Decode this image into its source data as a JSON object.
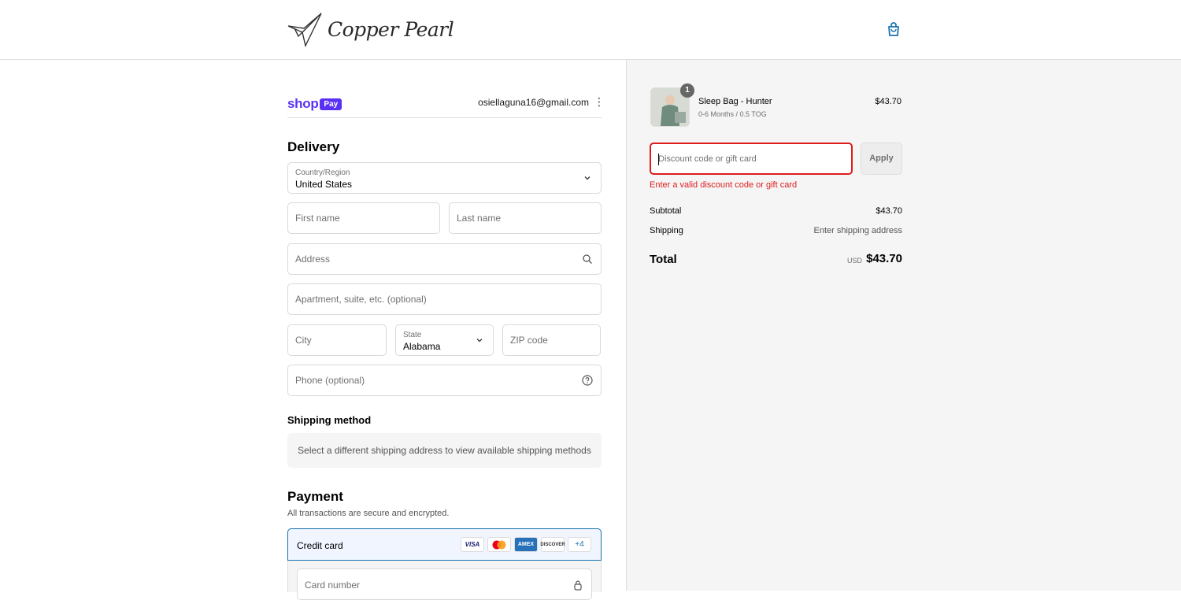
{
  "brand": {
    "name": "Copper Pearl"
  },
  "shop_pay": {
    "word": "shop",
    "badge": "Pay",
    "email": "osiellaguna16@gmail.com"
  },
  "delivery": {
    "heading": "Delivery",
    "country_label": "Country/Region",
    "country_value": "United States",
    "first_name_ph": "First name",
    "last_name_ph": "Last name",
    "address_ph": "Address",
    "apartment_ph": "Apartment, suite, etc. (optional)",
    "city_ph": "City",
    "state_label": "State",
    "state_value": "Alabama",
    "zip_ph": "ZIP code",
    "phone_ph": "Phone (optional)"
  },
  "shipping": {
    "heading": "Shipping method",
    "message": "Select a different shipping address to view available shipping methods"
  },
  "payment": {
    "heading": "Payment",
    "subtext": "All transactions are secure and encrypted.",
    "method_label": "Credit card",
    "cards": [
      "VISA",
      "MC",
      "AMEX",
      "DISCOVER",
      "+4"
    ],
    "card_number_ph": "Card number"
  },
  "order": {
    "item_name": "Sleep Bag - Hunter",
    "item_variant": "0-6 Months / 0.5 TOG",
    "item_price": "$43.70",
    "item_qty": "1",
    "discount_ph": "Discount code or gift card",
    "apply_label": "Apply",
    "discount_error": "Enter a valid discount code or gift card",
    "subtotal_label": "Subtotal",
    "subtotal_value": "$43.70",
    "shipping_label": "Shipping",
    "shipping_value": "Enter shipping address",
    "total_label": "Total",
    "total_currency": "USD",
    "total_value": "$43.70"
  },
  "colors": {
    "accent": "#1773b0",
    "shop_pay": "#5a31f4",
    "error": "#dd1d1d"
  }
}
